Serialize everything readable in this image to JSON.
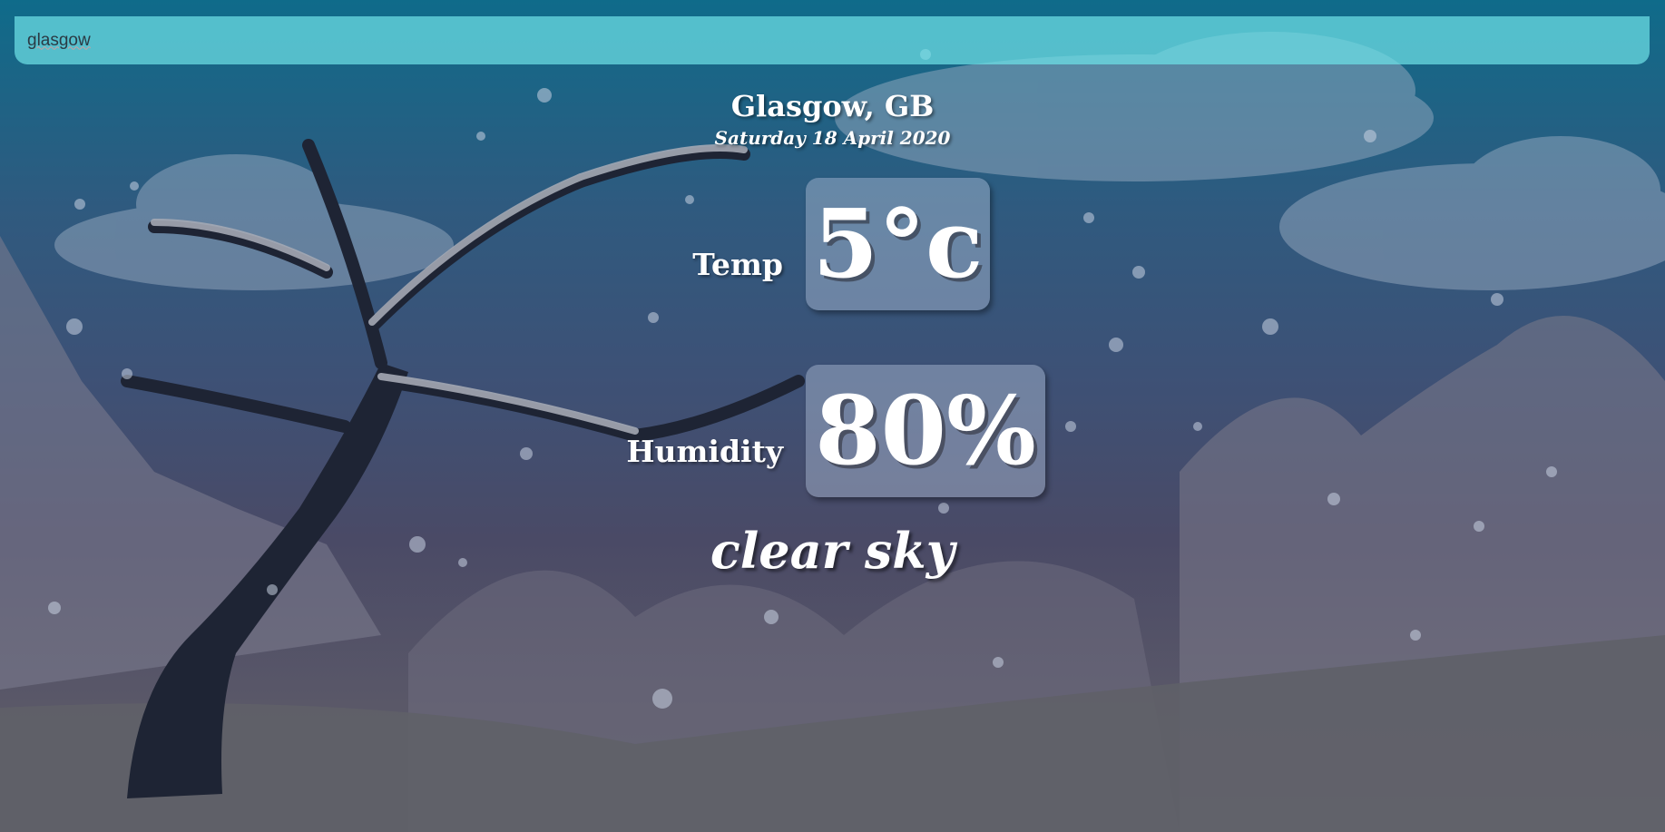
{
  "search": {
    "value": "glasgow",
    "placeholder": ""
  },
  "weather": {
    "location": "Glasgow, GB",
    "date": "Saturday 18 April 2020",
    "temp_label": "Temp",
    "temp_value": "5°c",
    "humidity_label": "Humidity",
    "humidity_value": "80%",
    "description": "clear sky"
  },
  "colors": {
    "search_bar": "#6ee1e6",
    "sky_top": "#0f6b8a",
    "sky_bottom": "#5d5e6b",
    "text": "#ffffff"
  },
  "background": {
    "icon": "snowy-tree-landscape"
  }
}
